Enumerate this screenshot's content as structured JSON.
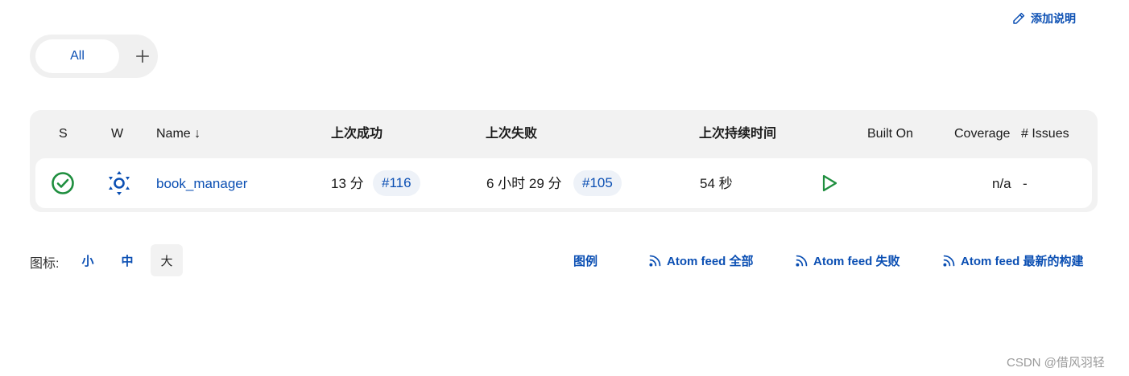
{
  "header": {
    "add_description": "添加说明",
    "add_description_icon": "pencil-icon"
  },
  "view_tabs": {
    "items": [
      {
        "label": "All",
        "active": true
      }
    ],
    "add_icon": "plus-icon"
  },
  "table": {
    "columns": {
      "status": "S",
      "weather": "W",
      "name": "Name ↓",
      "last_success": "上次成功",
      "last_failure": "上次失败",
      "last_duration": "上次持续时间",
      "built_on": "Built On",
      "coverage": "Coverage",
      "issues": "# Issues"
    },
    "rows": [
      {
        "status_icon": "success-check-icon",
        "weather_icon": "sunny-weather-icon",
        "name": "book_manager",
        "last_success_time": "13 分",
        "last_success_build": "#116",
        "last_failure_time": "6 小时 29 分",
        "last_failure_build": "#105",
        "last_duration": "54 秒",
        "run_icon": "play-icon",
        "coverage": "n/a",
        "issues": "-"
      }
    ]
  },
  "footer": {
    "icon_label": "图标:",
    "sizes": [
      {
        "label": "小",
        "active": false
      },
      {
        "label": "中",
        "active": false
      },
      {
        "label": "大",
        "active": true
      }
    ],
    "legend": "图例",
    "feeds": [
      {
        "label": "Atom feed 全部",
        "icon": "rss-icon"
      },
      {
        "label": "Atom feed 失败",
        "icon": "rss-icon"
      },
      {
        "label": "Atom feed 最新的构建",
        "icon": "rss-icon"
      }
    ]
  },
  "watermark": "CSDN @借风羽轻",
  "colors": {
    "link": "#0b4fb3",
    "success": "#1e8e3e",
    "panel": "#f2f2f2"
  }
}
